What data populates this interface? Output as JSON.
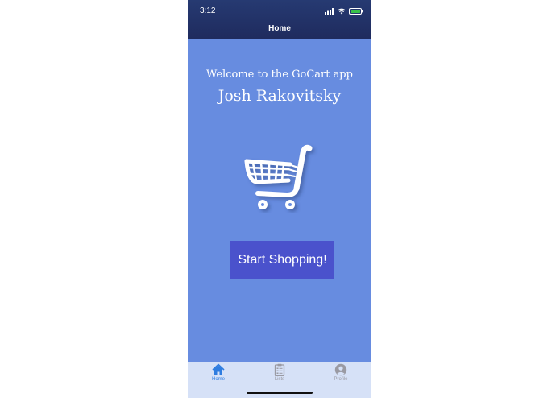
{
  "status_bar": {
    "time": "3:12"
  },
  "header": {
    "title": "Home"
  },
  "main": {
    "welcome_text": "Welcome to the GoCart app",
    "user_name": "Josh Rakovitsky",
    "start_button_label": "Start Shopping!"
  },
  "tabs": [
    {
      "label": "Home",
      "icon": "home-icon",
      "active": true
    },
    {
      "label": "Lists",
      "icon": "clipboard-list-icon",
      "active": false
    },
    {
      "label": "Profile",
      "icon": "user-avatar-icon",
      "active": false
    }
  ],
  "colors": {
    "header_bg": "#1f2b5e",
    "content_bg": "#678ce0",
    "button_bg": "#4a52cc",
    "tabbar_bg": "#d6e1f7",
    "tab_active": "#2f7de0",
    "tab_inactive": "#9a9aa3"
  }
}
